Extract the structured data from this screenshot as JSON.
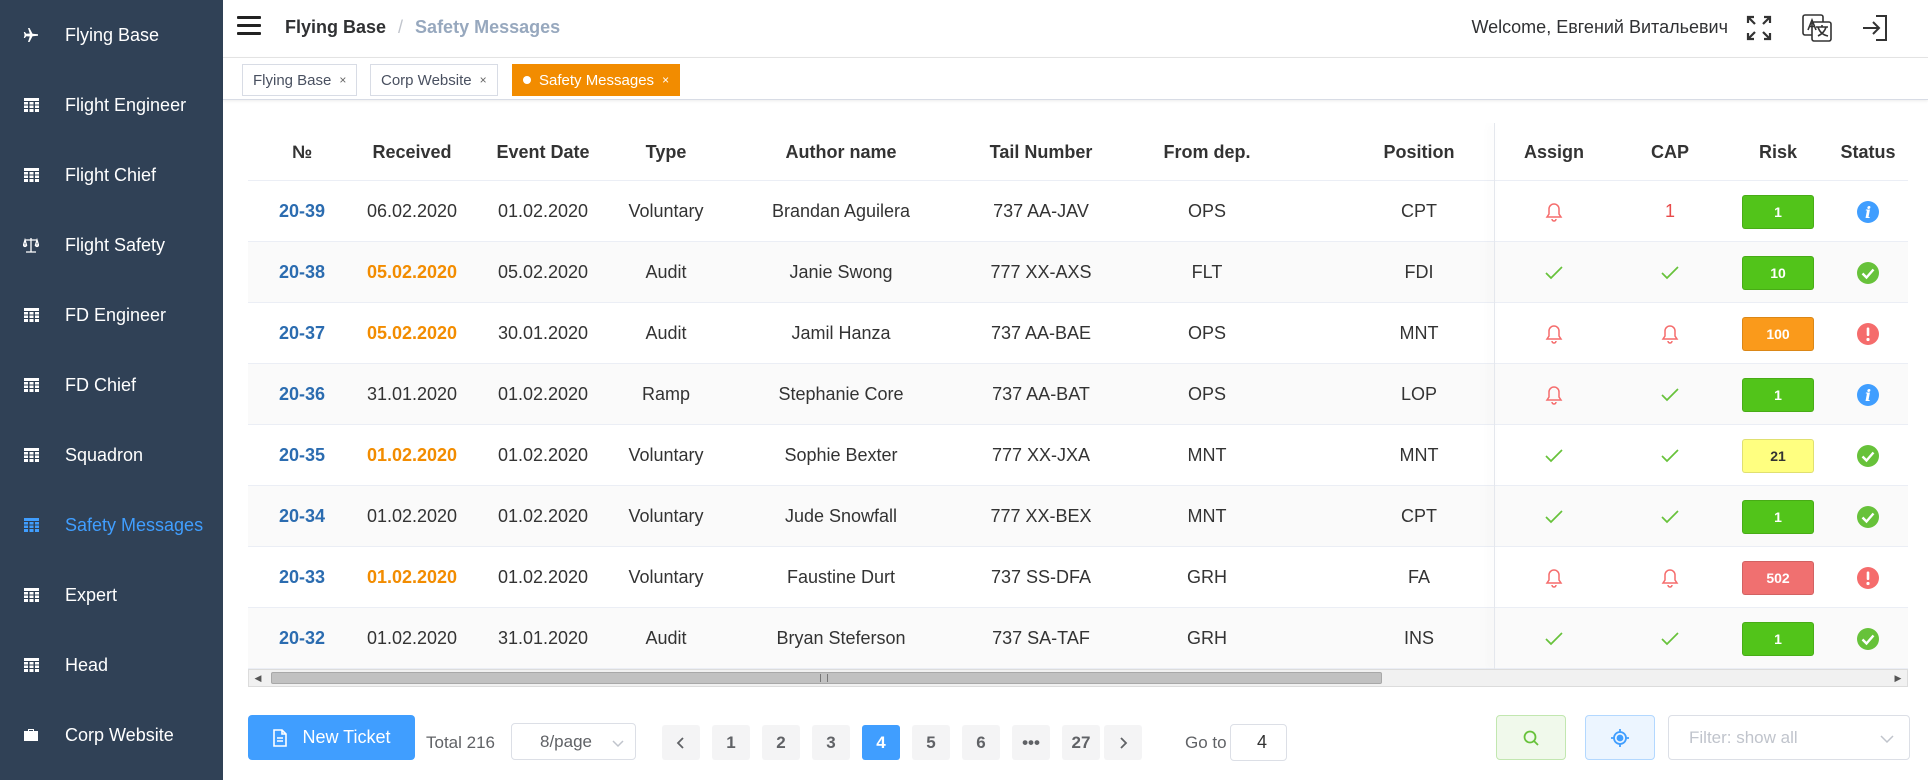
{
  "sidebar": {
    "items": [
      {
        "label": "Flying Base",
        "icon": "plane-icon",
        "active": false
      },
      {
        "label": "Flight Engineer",
        "icon": "table-icon",
        "active": false
      },
      {
        "label": "Flight Chief",
        "icon": "table-icon",
        "active": false
      },
      {
        "label": "Flight Safety",
        "icon": "scales-icon",
        "active": false
      },
      {
        "label": "FD Engineer",
        "icon": "table-icon",
        "active": false
      },
      {
        "label": "FD Chief",
        "icon": "table-icon",
        "active": false
      },
      {
        "label": "Squadron",
        "icon": "table-icon",
        "active": false
      },
      {
        "label": "Safety Messages",
        "icon": "table-icon",
        "active": true
      },
      {
        "label": "Expert",
        "icon": "table-icon",
        "active": false
      },
      {
        "label": "Head",
        "icon": "table-icon",
        "active": false
      },
      {
        "label": "Corp Website",
        "icon": "briefcase-icon",
        "active": false
      }
    ]
  },
  "header": {
    "breadcrumb_first": "Flying Base",
    "breadcrumb_sep": "/",
    "breadcrumb_last": "Safety Messages",
    "welcome": "Welcome, Евгений Витальевич"
  },
  "tags": [
    {
      "label": "Flying Base",
      "close": "×",
      "active": false
    },
    {
      "label": "Corp Website",
      "close": "×",
      "active": false
    },
    {
      "label": "Safety Messages",
      "close": "×",
      "active": true
    }
  ],
  "table": {
    "columns": [
      "№",
      "Received",
      "Event Date",
      "Type",
      "Author name",
      "Tail Number",
      "From dep.",
      "Position",
      "Assign",
      "CAP",
      "Risk",
      "Status"
    ],
    "rows": [
      {
        "num": "20-39",
        "received": "06.02.2020",
        "received_highlight": false,
        "event": "01.02.2020",
        "type": "Voluntary",
        "author": "Brandan Aguilera",
        "tail": "737 AA-JAV",
        "dep": "OPS",
        "pos": "CPT",
        "assign": "bell",
        "cap": "1",
        "risk": "1",
        "risk_color": "green",
        "status": "info"
      },
      {
        "num": "20-38",
        "received": "05.02.2020",
        "received_highlight": true,
        "event": "05.02.2020",
        "type": "Audit",
        "author": "Janie Swong",
        "tail": "777 XX-AXS",
        "dep": "FLT",
        "pos": "FDI",
        "assign": "check",
        "cap": "check",
        "risk": "10",
        "risk_color": "green",
        "status": "ok"
      },
      {
        "num": "20-37",
        "received": "05.02.2020",
        "received_highlight": true,
        "event": "30.01.2020",
        "type": "Audit",
        "author": "Jamil Hanza",
        "tail": "737 AA-BAE",
        "dep": "OPS",
        "pos": "MNT",
        "assign": "bell",
        "cap": "bell",
        "risk": "100",
        "risk_color": "orange",
        "status": "alert"
      },
      {
        "num": "20-36",
        "received": "31.01.2020",
        "received_highlight": false,
        "event": "01.02.2020",
        "type": "Ramp",
        "author": "Stephanie Core",
        "tail": "737 AA-BAT",
        "dep": "OPS",
        "pos": "LOP",
        "assign": "bell",
        "cap": "check",
        "risk": "1",
        "risk_color": "green",
        "status": "info"
      },
      {
        "num": "20-35",
        "received": "01.02.2020",
        "received_highlight": true,
        "event": "01.02.2020",
        "type": "Voluntary",
        "author": "Sophie Bexter",
        "tail": "777 XX-JXA",
        "dep": "MNT",
        "pos": "MNT",
        "assign": "check",
        "cap": "check",
        "risk": "21",
        "risk_color": "yellow",
        "status": "ok"
      },
      {
        "num": "20-34",
        "received": "01.02.2020",
        "received_highlight": false,
        "event": "01.02.2020",
        "type": "Voluntary",
        "author": "Jude Snowfall",
        "tail": "777 XX-BEX",
        "dep": "MNT",
        "pos": "CPT",
        "assign": "check",
        "cap": "check",
        "risk": "1",
        "risk_color": "green",
        "status": "ok"
      },
      {
        "num": "20-33",
        "received": "01.02.2020",
        "received_highlight": true,
        "event": "01.02.2020",
        "type": "Voluntary",
        "author": "Faustine Durt",
        "tail": "737 SS-DFA",
        "dep": "GRH",
        "pos": "FA",
        "assign": "bell",
        "cap": "bell",
        "risk": "502",
        "risk_color": "red",
        "status": "alert"
      },
      {
        "num": "20-32",
        "received": "01.02.2020",
        "received_highlight": false,
        "event": "31.01.2020",
        "type": "Audit",
        "author": "Bryan Steferson",
        "tail": "737 SA-TAF",
        "dep": "GRH",
        "pos": "INS",
        "assign": "check",
        "cap": "check",
        "risk": "1",
        "risk_color": "green",
        "status": "ok"
      }
    ]
  },
  "colors": {
    "sidebar_bg": "#304156",
    "accent": "#409eff",
    "orange": "#f28c00",
    "green": "#67c23a",
    "red": "#f56c6c",
    "risk_green": "#52c41a",
    "risk_orange": "#fa9a1b",
    "risk_yellow": "#ffff80",
    "risk_red": "#f07070"
  },
  "footer": {
    "new_ticket": "New Ticket",
    "total": "Total 216",
    "page_size": "8/page",
    "pages": [
      "1",
      "2",
      "3",
      "4",
      "5",
      "6",
      "•••",
      "27"
    ],
    "current_page": "4",
    "goto_label": "Go to",
    "goto_value": "4",
    "filter_placeholder": "Filter: show all"
  }
}
